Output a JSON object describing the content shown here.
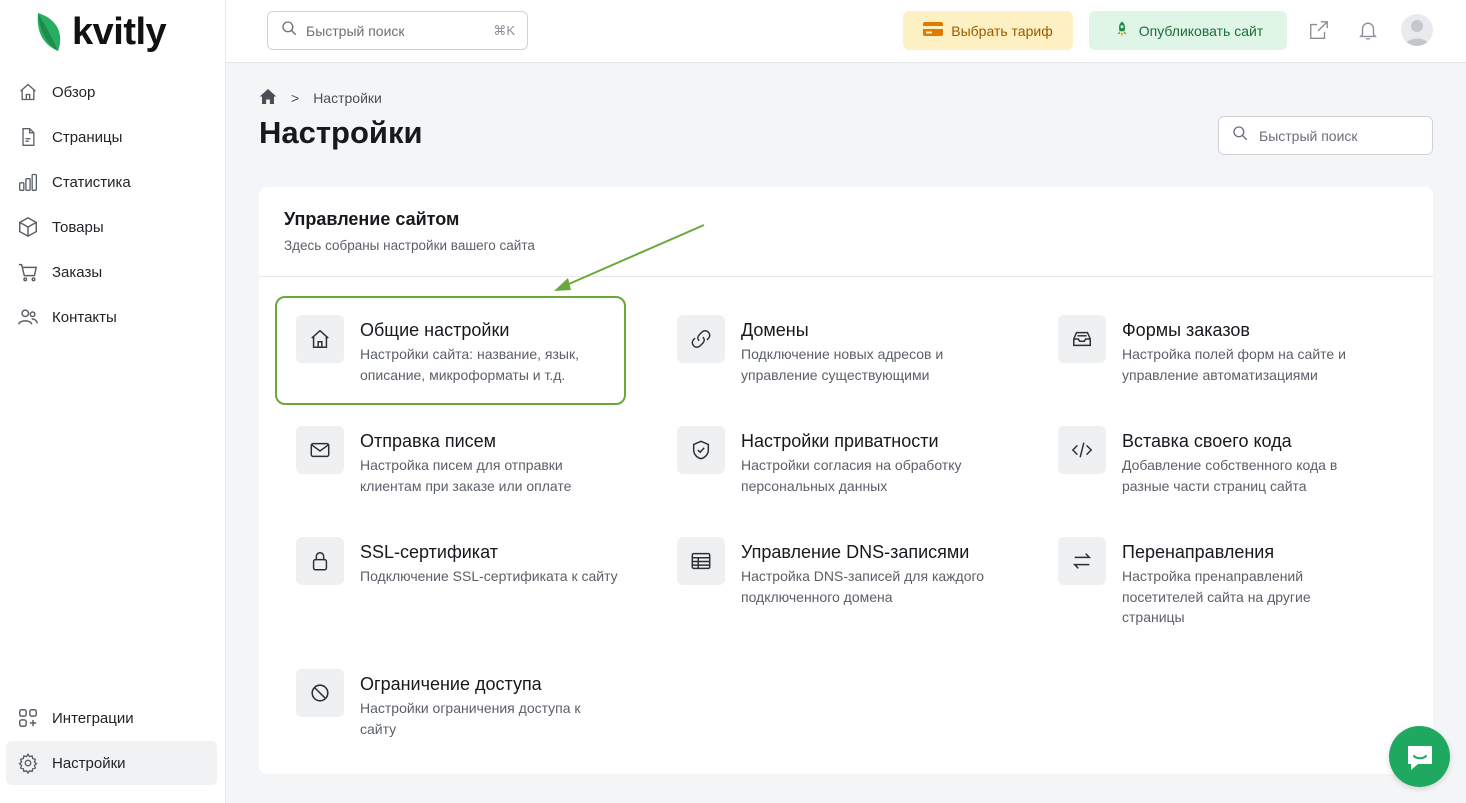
{
  "brand": {
    "name": "kvitly",
    "accent": "#27ae60"
  },
  "sidebar": {
    "items": [
      {
        "label": "Обзор",
        "icon": "home-icon"
      },
      {
        "label": "Страницы",
        "icon": "file-icon"
      },
      {
        "label": "Статистика",
        "icon": "bar-chart-icon"
      },
      {
        "label": "Товары",
        "icon": "box-icon"
      },
      {
        "label": "Заказы",
        "icon": "cart-icon"
      },
      {
        "label": "Контакты",
        "icon": "users-icon"
      }
    ],
    "bottom": [
      {
        "label": "Интеграции",
        "icon": "grid-plus-icon"
      },
      {
        "label": "Настройки",
        "icon": "gear-icon",
        "active": true
      }
    ]
  },
  "topbar": {
    "search_placeholder": "Быстрый поиск",
    "search_shortcut": "⌘K",
    "tariff_label": "Выбрать тариф",
    "publish_label": "Опубликовать сайт"
  },
  "main": {
    "breadcrumb": {
      "separator": ">",
      "current": "Настройки"
    },
    "title": "Настройки",
    "search_placeholder": "Быстрый поиск",
    "card": {
      "title": "Управление сайтом",
      "subtitle": "Здесь собраны настройки вашего сайта",
      "tiles": [
        {
          "title": "Общие настройки",
          "desc": "Настройки сайта: название, язык, описание, микроформаты и т.д.",
          "icon": "home-icon",
          "highlighted": true
        },
        {
          "title": "Домены",
          "desc": "Подключение новых адресов и управление существующими",
          "icon": "link-icon"
        },
        {
          "title": "Формы заказов",
          "desc": "Настройка полей форм на сайте и управление автоматизациями",
          "icon": "inbox-icon"
        },
        {
          "title": "Отправка писем",
          "desc": "Настройка писем для отправки клиентам при заказе или оплате",
          "icon": "mail-icon"
        },
        {
          "title": "Настройки приватности",
          "desc": "Настройки согласия на обработку персональных данных",
          "icon": "shield-check-icon"
        },
        {
          "title": "Вставка своего кода",
          "desc": "Добавление собственного кода в разные части страниц сайта",
          "icon": "code-icon"
        },
        {
          "title": "SSL-сертификат",
          "desc": "Подключение SSL-сертификата к сайту",
          "icon": "lock-icon"
        },
        {
          "title": "Управление DNS-записями",
          "desc": "Настройка DNS-записей для каждого подключенного домена",
          "icon": "table-icon"
        },
        {
          "title": "Перенаправления",
          "desc": "Настройка пренаправлений посетителей сайта на другие страницы",
          "icon": "arrows-swap-icon"
        },
        {
          "title": "Ограничение доступа",
          "desc": "Настройки ограничения доступа к сайту",
          "icon": "ban-icon"
        }
      ]
    }
  }
}
